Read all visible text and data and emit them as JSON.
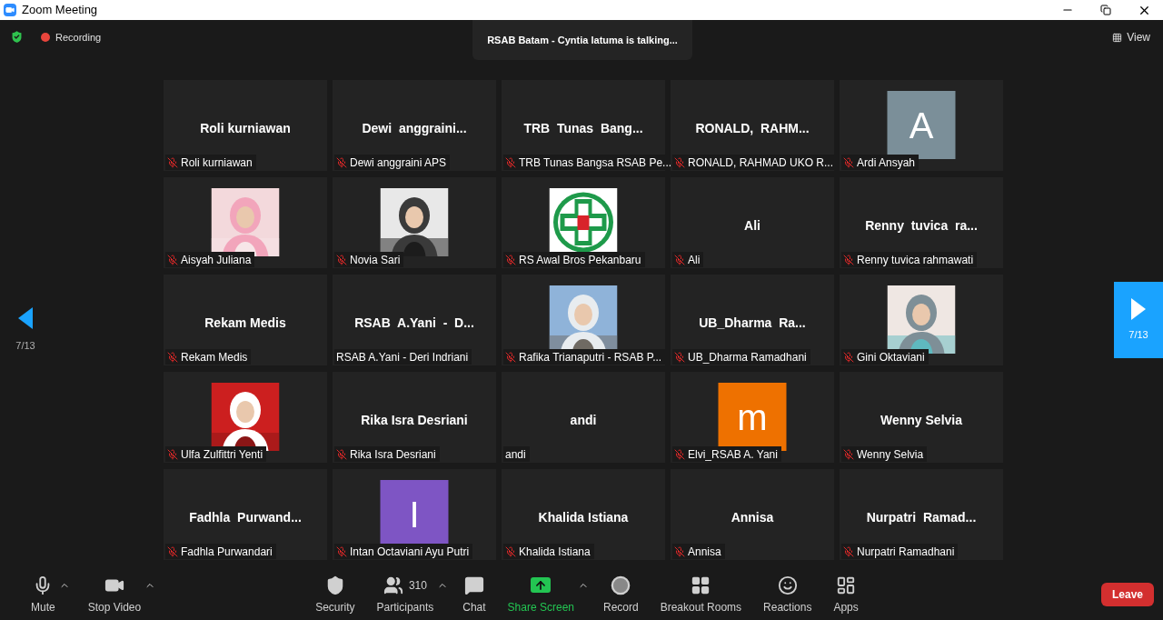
{
  "window": {
    "title": "Zoom Meeting"
  },
  "header": {
    "recording": "Recording",
    "talking": "RSAB Batam - Cyntia latuma is talking...",
    "view": "View"
  },
  "pager": {
    "prev": "7/13",
    "next": "7/13"
  },
  "tiles": [
    {
      "kind": "name",
      "name": "Roli kurniawan",
      "label": "Roli kurniawan",
      "muted": true
    },
    {
      "kind": "name",
      "name": "Dewi  anggraini...",
      "label": "Dewi anggraini APS",
      "muted": true
    },
    {
      "kind": "name",
      "name": "TRB  Tunas  Bang...",
      "label": "TRB Tunas Bangsa RSAB Pe...",
      "muted": true
    },
    {
      "kind": "name",
      "name": "RONALD,  RAHM...",
      "label": "RONALD, RAHMAD UKO R...",
      "muted": true
    },
    {
      "kind": "letter",
      "letter": "A",
      "color": "#7b8f99",
      "label": "Ardi Ansyah",
      "muted": true
    },
    {
      "kind": "picture",
      "label": "Aisyah Juliana",
      "muted": true
    },
    {
      "kind": "picture",
      "label": "Novia Sari",
      "muted": true
    },
    {
      "kind": "picture",
      "label": "RS Awal Bros Pekanbaru",
      "muted": true
    },
    {
      "kind": "name",
      "name": "Ali",
      "label": "Ali",
      "muted": true
    },
    {
      "kind": "name",
      "name": "Renny  tuvica  ra...",
      "label": "Renny tuvica rahmawati",
      "muted": true
    },
    {
      "kind": "name",
      "name": "Rekam Medis",
      "label": "Rekam Medis",
      "muted": true
    },
    {
      "kind": "name",
      "name": "RSAB  A.Yani  -  D...",
      "label": "RSAB A.Yani - Deri Indriani",
      "muted": false
    },
    {
      "kind": "picture",
      "label": "Rafika Trianaputri - RSAB P...",
      "muted": true
    },
    {
      "kind": "name",
      "name": "UB_Dharma  Ra...",
      "label": "UB_Dharma Ramadhani",
      "muted": true
    },
    {
      "kind": "picture",
      "label": "Gini Oktaviani",
      "muted": true
    },
    {
      "kind": "picture",
      "label": "Ulfa Zulfittri Yenti",
      "muted": true
    },
    {
      "kind": "name",
      "name": "Rika Isra Desriani",
      "label": "Rika Isra Desriani",
      "muted": true
    },
    {
      "kind": "name",
      "name": "andi",
      "label": "andi",
      "muted": false
    },
    {
      "kind": "letter",
      "letter": "m",
      "color": "#ee7100",
      "label": "Elvi_RSAB A. Yani",
      "muted": true
    },
    {
      "kind": "name",
      "name": "Wenny Selvia",
      "label": "Wenny Selvia",
      "muted": true
    },
    {
      "kind": "name",
      "name": "Fadhla  Purwand...",
      "label": "Fadhla Purwandari",
      "muted": true
    },
    {
      "kind": "letter",
      "letter": "I",
      "color": "#7e55c4",
      "label": "Intan Octaviani Ayu Putri",
      "muted": true
    },
    {
      "kind": "name",
      "name": "Khalida Istiana",
      "label": "Khalida Istiana",
      "muted": true
    },
    {
      "kind": "name",
      "name": "Annisa",
      "label": "Annisa",
      "muted": true
    },
    {
      "kind": "name",
      "name": "Nurpatri  Ramad...",
      "label": "Nurpatri Ramadhani",
      "muted": true
    }
  ],
  "toolbar": [
    {
      "kind": "mute",
      "label": "Mute",
      "caret": true
    },
    {
      "kind": "video",
      "label": "Stop Video",
      "caret": true
    },
    {
      "kind": "security",
      "label": "Security",
      "caret": false
    },
    {
      "kind": "participants",
      "label": "Participants",
      "count": "310",
      "caret": true
    },
    {
      "kind": "chat",
      "label": "Chat",
      "caret": false
    },
    {
      "kind": "share",
      "label": "Share Screen",
      "caret": true
    },
    {
      "kind": "record",
      "label": "Record",
      "caret": false
    },
    {
      "kind": "breakout",
      "label": "Breakout Rooms",
      "caret": false
    },
    {
      "kind": "reactions",
      "label": "Reactions",
      "caret": false
    },
    {
      "kind": "apps",
      "label": "Apps",
      "caret": false
    }
  ],
  "leave": "Leave"
}
